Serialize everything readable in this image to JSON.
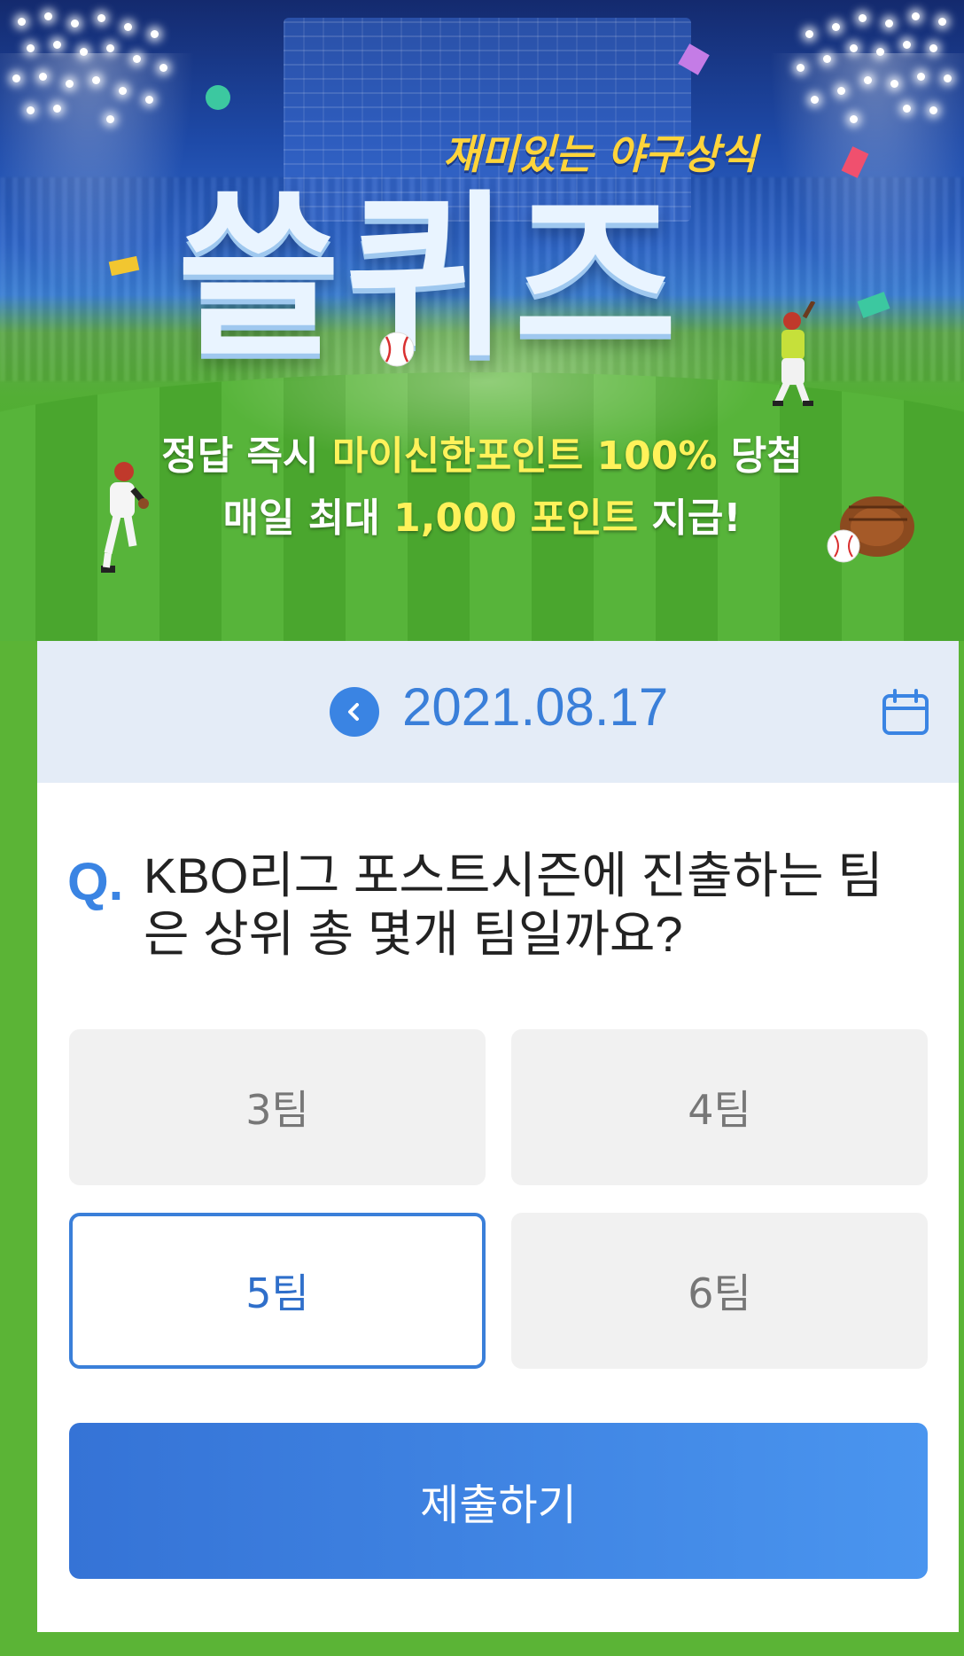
{
  "hero": {
    "subtitle": "재미있는 야구상식",
    "title": "쓸퀴즈",
    "line1_a": "정답 즉시 ",
    "line1_highlight": "마이신한포인트 100%",
    "line1_b": " 당첨",
    "line2_a": "매일 최대 ",
    "line2_highlight": "1,000 포인트",
    "line2_b": " 지급!"
  },
  "date_bar": {
    "date": "2021.08.17",
    "prev_icon": "chevron-left-circle-icon",
    "calendar_icon": "calendar-icon"
  },
  "question": {
    "prefix": "Q.",
    "text": "KBO리그 포스트시즌에 진출하는 팀은 상위 총 몇개 팀일까요?"
  },
  "options": [
    {
      "label": "3팀",
      "selected": false
    },
    {
      "label": "4팀",
      "selected": false
    },
    {
      "label": "5팀",
      "selected": true
    },
    {
      "label": "6팀",
      "selected": false
    }
  ],
  "submit_label": "제출하기",
  "colors": {
    "accent": "#3a84e3",
    "field_green": "#5bb436",
    "highlight_yellow": "#fff25a"
  }
}
